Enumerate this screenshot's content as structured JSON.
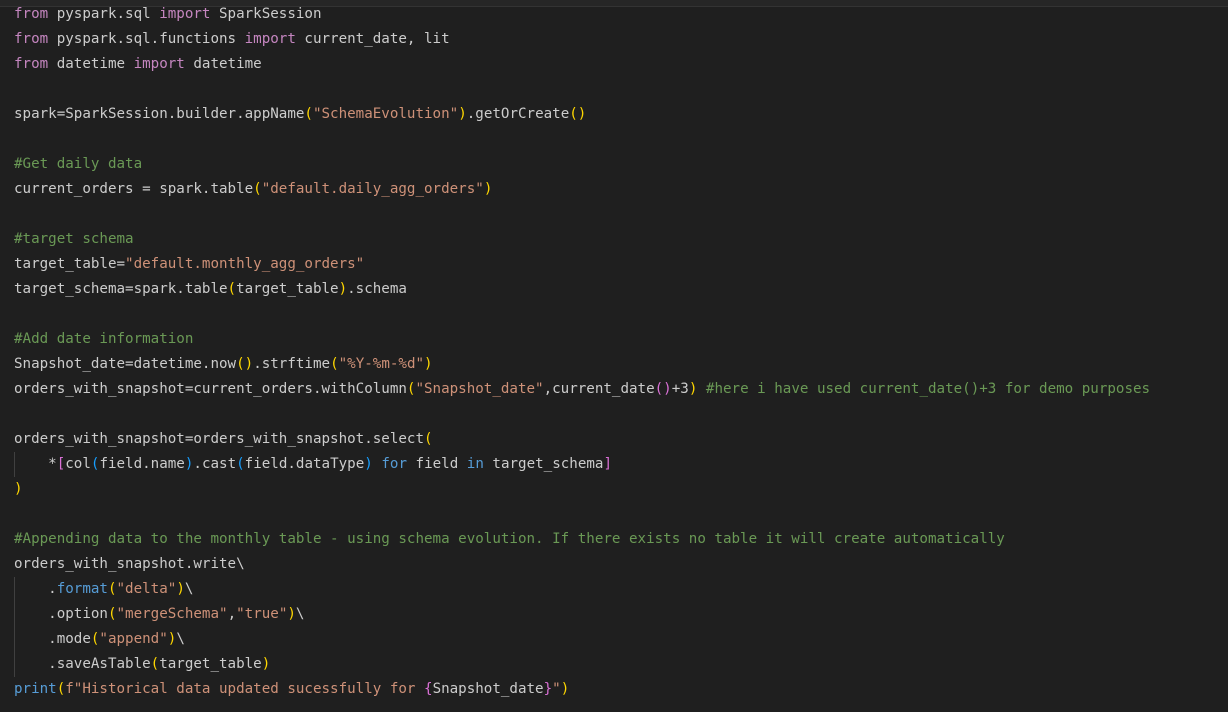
{
  "editor": {
    "language": "python",
    "colors": {
      "background": "#1f1f1f",
      "keyword": "#569cd6",
      "import_kw": "#c586c0",
      "string": "#ce9178",
      "comment": "#6a9955",
      "default": "#cccccc",
      "bracket1": "#ffd700",
      "bracket2": "#da70d6",
      "bracket3": "#179fff"
    },
    "lines": [
      {
        "guide": false,
        "segs": [
          {
            "t": "from",
            "c": "import_kw"
          },
          {
            "t": " pyspark.sql ",
            "c": "default"
          },
          {
            "t": "import",
            "c": "import_kw"
          },
          {
            "t": " SparkSession",
            "c": "default"
          }
        ]
      },
      {
        "guide": false,
        "segs": [
          {
            "t": "from",
            "c": "import_kw"
          },
          {
            "t": " pyspark.sql.functions ",
            "c": "default"
          },
          {
            "t": "import",
            "c": "import_kw"
          },
          {
            "t": " current_date, lit",
            "c": "default"
          }
        ]
      },
      {
        "guide": false,
        "segs": [
          {
            "t": "from",
            "c": "import_kw"
          },
          {
            "t": " datetime ",
            "c": "default"
          },
          {
            "t": "import",
            "c": "import_kw"
          },
          {
            "t": " datetime",
            "c": "default"
          }
        ]
      },
      {
        "guide": false,
        "segs": []
      },
      {
        "guide": false,
        "segs": [
          {
            "t": "spark=SparkSession.builder.appName",
            "c": "default"
          },
          {
            "t": "(",
            "c": "bracket1"
          },
          {
            "t": "\"SchemaEvolution\"",
            "c": "string"
          },
          {
            "t": ")",
            "c": "bracket1"
          },
          {
            "t": ".getOrCreate",
            "c": "default"
          },
          {
            "t": "()",
            "c": "bracket1"
          }
        ]
      },
      {
        "guide": false,
        "segs": []
      },
      {
        "guide": false,
        "segs": [
          {
            "t": "#Get daily data",
            "c": "comment"
          }
        ]
      },
      {
        "guide": false,
        "segs": [
          {
            "t": "current_orders = spark.table",
            "c": "default"
          },
          {
            "t": "(",
            "c": "bracket1"
          },
          {
            "t": "\"default.daily_agg_orders\"",
            "c": "string"
          },
          {
            "t": ")",
            "c": "bracket1"
          }
        ]
      },
      {
        "guide": false,
        "segs": []
      },
      {
        "guide": false,
        "segs": [
          {
            "t": "#target schema",
            "c": "comment"
          }
        ]
      },
      {
        "guide": false,
        "segs": [
          {
            "t": "target_table=",
            "c": "default"
          },
          {
            "t": "\"default.monthly_agg_orders\"",
            "c": "string"
          }
        ]
      },
      {
        "guide": false,
        "segs": [
          {
            "t": "target_schema=spark.table",
            "c": "default"
          },
          {
            "t": "(",
            "c": "bracket1"
          },
          {
            "t": "target_table",
            "c": "default"
          },
          {
            "t": ")",
            "c": "bracket1"
          },
          {
            "t": ".schema",
            "c": "default"
          }
        ]
      },
      {
        "guide": false,
        "segs": []
      },
      {
        "guide": false,
        "segs": [
          {
            "t": "#Add date information",
            "c": "comment"
          }
        ]
      },
      {
        "guide": false,
        "segs": [
          {
            "t": "Snapshot_date=datetime.now",
            "c": "default"
          },
          {
            "t": "()",
            "c": "bracket1"
          },
          {
            "t": ".strftime",
            "c": "default"
          },
          {
            "t": "(",
            "c": "bracket1"
          },
          {
            "t": "\"%Y-%m-%d\"",
            "c": "string"
          },
          {
            "t": ")",
            "c": "bracket1"
          }
        ]
      },
      {
        "guide": false,
        "segs": [
          {
            "t": "orders_with_snapshot=current_orders.withColumn",
            "c": "default"
          },
          {
            "t": "(",
            "c": "bracket1"
          },
          {
            "t": "\"Snapshot_date\"",
            "c": "string"
          },
          {
            "t": ",current_date",
            "c": "default"
          },
          {
            "t": "()",
            "c": "bracket2"
          },
          {
            "t": "+3",
            "c": "default"
          },
          {
            "t": ")",
            "c": "bracket1"
          },
          {
            "t": " ",
            "c": "default"
          },
          {
            "t": "#here i have used current_date()+3 for demo purposes",
            "c": "comment"
          }
        ]
      },
      {
        "guide": false,
        "segs": []
      },
      {
        "guide": false,
        "segs": [
          {
            "t": "orders_with_snapshot=orders_with_snapshot.select",
            "c": "default"
          },
          {
            "t": "(",
            "c": "bracket1"
          }
        ]
      },
      {
        "guide": true,
        "segs": [
          {
            "t": "    *",
            "c": "default"
          },
          {
            "t": "[",
            "c": "bracket2"
          },
          {
            "t": "col",
            "c": "default"
          },
          {
            "t": "(",
            "c": "bracket3"
          },
          {
            "t": "field.name",
            "c": "default"
          },
          {
            "t": ")",
            "c": "bracket3"
          },
          {
            "t": ".cast",
            "c": "default"
          },
          {
            "t": "(",
            "c": "bracket3"
          },
          {
            "t": "field.dataType",
            "c": "default"
          },
          {
            "t": ")",
            "c": "bracket3"
          },
          {
            "t": " ",
            "c": "default"
          },
          {
            "t": "for",
            "c": "keyword"
          },
          {
            "t": " field ",
            "c": "default"
          },
          {
            "t": "in",
            "c": "keyword"
          },
          {
            "t": " target_schema",
            "c": "default"
          },
          {
            "t": "]",
            "c": "bracket2"
          }
        ]
      },
      {
        "guide": false,
        "segs": [
          {
            "t": ")",
            "c": "bracket1"
          }
        ]
      },
      {
        "guide": false,
        "segs": []
      },
      {
        "guide": false,
        "segs": [
          {
            "t": "#Appending data to the monthly table - using schema evolution. If there exists no table it will create automatically",
            "c": "comment"
          }
        ]
      },
      {
        "guide": false,
        "segs": [
          {
            "t": "orders_with_snapshot.write\\",
            "c": "default"
          }
        ]
      },
      {
        "guide": true,
        "segs": [
          {
            "t": "    .",
            "c": "default"
          },
          {
            "t": "format",
            "c": "keyword"
          },
          {
            "t": "(",
            "c": "bracket1"
          },
          {
            "t": "\"delta\"",
            "c": "string"
          },
          {
            "t": ")",
            "c": "bracket1"
          },
          {
            "t": "\\",
            "c": "default"
          }
        ]
      },
      {
        "guide": true,
        "segs": [
          {
            "t": "    .option",
            "c": "default"
          },
          {
            "t": "(",
            "c": "bracket1"
          },
          {
            "t": "\"mergeSchema\"",
            "c": "string"
          },
          {
            "t": ",",
            "c": "default"
          },
          {
            "t": "\"true\"",
            "c": "string"
          },
          {
            "t": ")",
            "c": "bracket1"
          },
          {
            "t": "\\",
            "c": "default"
          }
        ]
      },
      {
        "guide": true,
        "segs": [
          {
            "t": "    .mode",
            "c": "default"
          },
          {
            "t": "(",
            "c": "bracket1"
          },
          {
            "t": "\"append\"",
            "c": "string"
          },
          {
            "t": ")",
            "c": "bracket1"
          },
          {
            "t": "\\",
            "c": "default"
          }
        ]
      },
      {
        "guide": true,
        "segs": [
          {
            "t": "    .saveAsTable",
            "c": "default"
          },
          {
            "t": "(",
            "c": "bracket1"
          },
          {
            "t": "target_table",
            "c": "default"
          },
          {
            "t": ")",
            "c": "bracket1"
          }
        ]
      },
      {
        "guide": false,
        "segs": [
          {
            "t": "print",
            "c": "keyword"
          },
          {
            "t": "(",
            "c": "bracket1"
          },
          {
            "t": "f\"Historical data updated sucessfully for ",
            "c": "string"
          },
          {
            "t": "{",
            "c": "bracket2"
          },
          {
            "t": "Snapshot_date",
            "c": "default"
          },
          {
            "t": "}",
            "c": "bracket2"
          },
          {
            "t": "\"",
            "c": "string"
          },
          {
            "t": ")",
            "c": "bracket1"
          }
        ]
      }
    ]
  }
}
